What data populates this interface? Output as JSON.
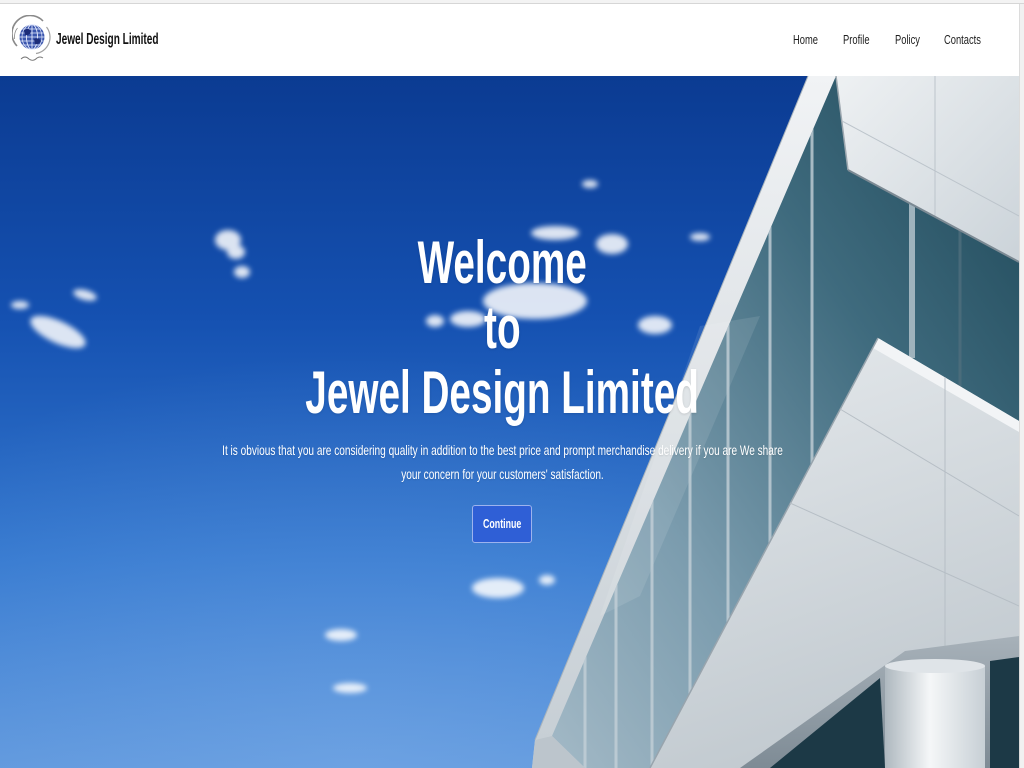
{
  "header": {
    "brand_name": "Jewel Design Limited",
    "logo_icon": "globe-logo-icon",
    "nav": [
      {
        "label": "Home"
      },
      {
        "label": "Profile"
      },
      {
        "label": "Policy"
      },
      {
        "label": "Contacts"
      }
    ]
  },
  "hero": {
    "title_lines": [
      "Welcome",
      "to",
      "Jewel Design Limited"
    ],
    "description": "It is obvious that you are considering quality in addition to the best price and prompt merchandise delivery if you are We share your concern for your customers' satisfaction.",
    "cta_label": "Continue"
  },
  "colors": {
    "header_background": "#ffffff",
    "hero_text": "#ffffff",
    "cta_background": "#2f5fd6",
    "sky_top": "#0b3b92",
    "sky_bottom": "#5d96dc"
  }
}
